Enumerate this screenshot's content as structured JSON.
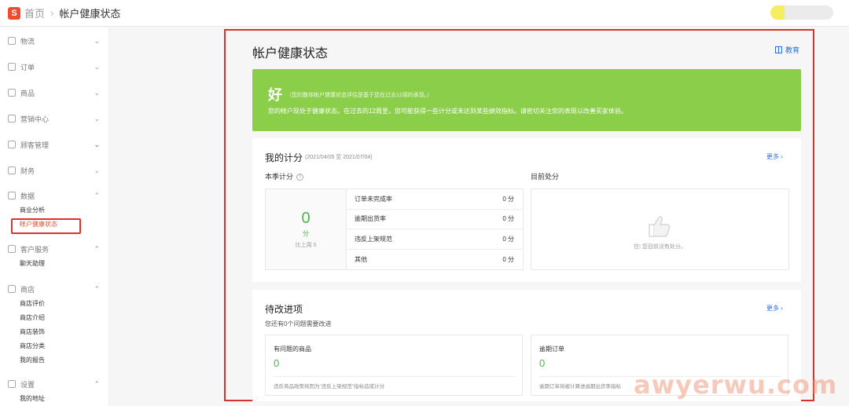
{
  "topbar": {
    "logo_letter": "S",
    "home": "首页",
    "separator": "›",
    "current": "帐户健康状态"
  },
  "sidebar": {
    "groups": [
      {
        "label": "物流",
        "chevron": "⌄",
        "items": []
      },
      {
        "label": "订单",
        "chevron": "⌄",
        "items": []
      },
      {
        "label": "商品",
        "chevron": "⌄",
        "items": []
      },
      {
        "label": "营销中心",
        "chevron": "⌄",
        "items": []
      },
      {
        "label": "顾客管理",
        "chevron": "⌄",
        "items": []
      },
      {
        "label": "财务",
        "chevron": "⌄",
        "items": []
      },
      {
        "label": "数据",
        "chevron": "⌃",
        "items": [
          "商业分析",
          "帐户健康状态"
        ]
      },
      {
        "label": "客户服务",
        "chevron": "⌃",
        "items": [
          "聊天助理"
        ]
      },
      {
        "label": "商店",
        "chevron": "⌃",
        "items": [
          "商店评价",
          "商店介绍",
          "商店装饰",
          "商店分类",
          "我的报告"
        ]
      },
      {
        "label": "设置",
        "chevron": "⌃",
        "items": [
          "我的地址"
        ]
      }
    ],
    "active_item": "帐户健康状态"
  },
  "main": {
    "title": "帐户健康状态",
    "edu_label": "教育",
    "banner": {
      "status": "好",
      "note": "（您的整体帐户健康状态评估是基于您在过去12周的表现。）",
      "description": "您的帐户现处于健康状态。在过去的12周里，您可能获得一些计分或未达到某些绩效指标。请密切关注您的表现以改善买家体验。"
    },
    "score": {
      "title": "我的计分",
      "range": "(2021/04/05 至 2021/07/04)",
      "more": "更多 ›",
      "season_label": "本季计分",
      "help": "?",
      "total": "0",
      "unit": "分",
      "compare": "比上周 0",
      "rows": [
        {
          "label": "订单未完成率",
          "value": "0 分"
        },
        {
          "label": "逾期出货率",
          "value": "0 分"
        },
        {
          "label": "违反上架规范",
          "value": "0 分"
        },
        {
          "label": "其他",
          "value": "0 分"
        }
      ],
      "penalty_label": "目前处分",
      "penalty_empty": "住! 您目前没有处分。"
    },
    "todo": {
      "title": "待改进项",
      "subtitle": "您还有0个问题需要改进",
      "more": "更多 ›",
      "boxes": [
        {
          "label": "有问题的商品",
          "value": "0",
          "footer": "违反商品政策将因为\"违反上架规范\"指标造成计分"
        },
        {
          "label": "逾期订单",
          "value": "0",
          "footer": "逾期订单将被计算进逾期出货率指标"
        }
      ]
    }
  },
  "watermark": "awyerwu.com",
  "colors": {
    "brand": "#ee4d2d",
    "banner_green": "#8bce49",
    "score_green": "#4bb648",
    "link_blue": "#2a6fdb",
    "annotation_red": "#d7322b"
  }
}
